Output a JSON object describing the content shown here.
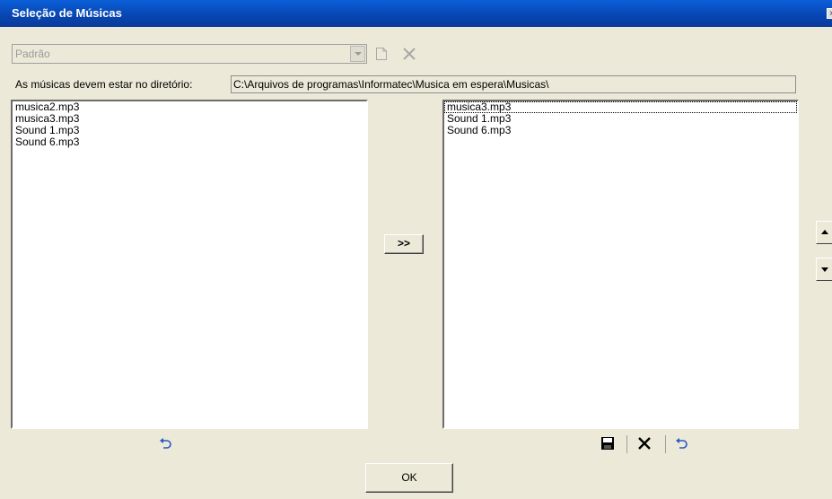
{
  "window": {
    "title": "Seleção de Músicas",
    "close_glyph": "×"
  },
  "profile_combo": {
    "value": "Padrão",
    "enabled": false
  },
  "toolbar_top": [
    {
      "icon": "new-document-icon",
      "enabled": false
    },
    {
      "icon": "delete-x-icon",
      "enabled": false
    }
  ],
  "directory": {
    "label": "As músicas devem estar no diretório:",
    "path": "C:\\Arquivos de programas\\Informatec\\Musica em espera\\Musicas\\"
  },
  "available_list": {
    "items": [
      "musica2.mp3",
      "musica3.mp3",
      "Sound 1.mp3",
      "Sound 6.mp3"
    ]
  },
  "selected_list": {
    "items": [
      "musica3.mp3",
      "Sound 1.mp3",
      "Sound 6.mp3"
    ],
    "focused_index": 0
  },
  "transfer_button": {
    "label": ">>"
  },
  "move_buttons": {
    "up_icon": "arrow-up-icon",
    "down_icon": "arrow-down-icon"
  },
  "bottom_left_tools": [
    {
      "icon": "undo-icon"
    }
  ],
  "bottom_right_tools": [
    {
      "icon": "save-icon"
    },
    {
      "icon": "delete-x-icon"
    },
    {
      "icon": "undo-icon"
    }
  ],
  "ok_button": {
    "label": "OK"
  },
  "colors": {
    "title_bar": "#0845b0",
    "dialog_bg": "#ece9d8",
    "icon_blue": "#2a56c6",
    "disabled_gray": "#9a9a9a"
  }
}
